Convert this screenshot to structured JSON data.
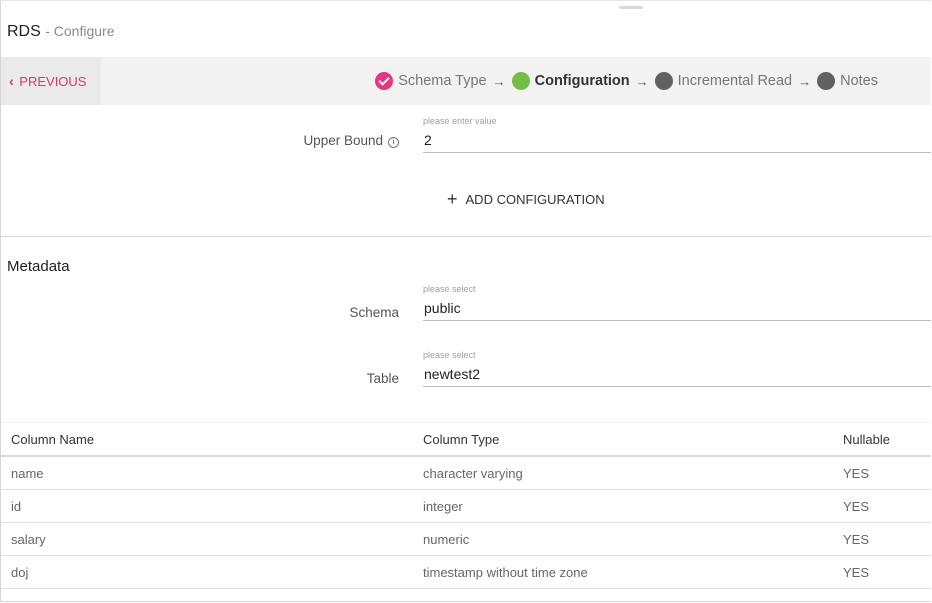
{
  "header": {
    "title": "RDS",
    "subtitle": "- Configure"
  },
  "nav": {
    "previous_label": "PREVIOUS"
  },
  "steps": [
    {
      "label": "Schema Type",
      "state": "done",
      "color": "#e7367a"
    },
    {
      "label": "Configuration",
      "state": "active",
      "color": "#72bf44"
    },
    {
      "label": "Incremental Read",
      "state": "pending",
      "color": "#616161"
    },
    {
      "label": "Notes",
      "state": "pending",
      "color": "#616161"
    }
  ],
  "upper_bound": {
    "label": "Upper Bound",
    "placeholder": "please enter value",
    "value": "2"
  },
  "add_configuration_label": "ADD CONFIGURATION",
  "metadata": {
    "title": "Metadata",
    "schema": {
      "label": "Schema",
      "placeholder": "please select",
      "value": "public"
    },
    "table": {
      "label": "Table",
      "placeholder": "please select",
      "value": "newtest2"
    }
  },
  "columns_table": {
    "headers": [
      "Column Name",
      "Column Type",
      "Nullable"
    ],
    "rows": [
      [
        "name",
        "character varying",
        "YES"
      ],
      [
        "id",
        "integer",
        "YES"
      ],
      [
        "salary",
        "numeric",
        "YES"
      ],
      [
        "doj",
        "timestamp without time zone",
        "YES"
      ]
    ]
  }
}
